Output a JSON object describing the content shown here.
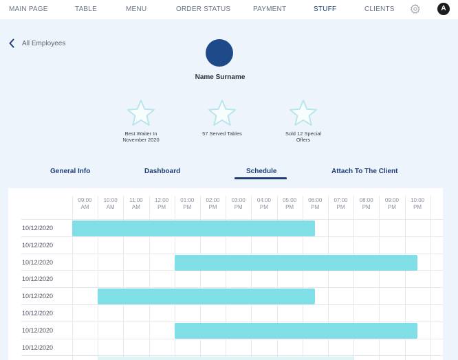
{
  "nav": {
    "items": [
      "MAIN PAGE",
      "TABLE",
      "MENU",
      "ORDER STATUS",
      "PAYMENT",
      "STUFF",
      "CLIENTS"
    ],
    "active": "STUFF",
    "settings_icon": "gear-icon",
    "user_initial": "A"
  },
  "back": {
    "label": "All Employees",
    "icon": "chevron-left-icon"
  },
  "profile": {
    "name": "Name Surname",
    "avatar_color": "#1f4a8a"
  },
  "achievements": [
    {
      "icon": "star-icon",
      "label_line1": "Best Waiter In",
      "label_line2": "November 2020"
    },
    {
      "icon": "star-icon",
      "label_line1": "57 Served Tables",
      "label_line2": ""
    },
    {
      "icon": "star-icon",
      "label_line1": "Sold 12 Special",
      "label_line2": "Offers"
    }
  ],
  "tabs": [
    "General Info",
    "Dashboard",
    "Schedule",
    "Attach To The Client"
  ],
  "active_tab": "Schedule",
  "schedule": {
    "times": [
      {
        "time": "09:00",
        "ampm": "AM"
      },
      {
        "time": "10:00",
        "ampm": "AM"
      },
      {
        "time": "11:00",
        "ampm": "AM"
      },
      {
        "time": "12:00",
        "ampm": "PM"
      },
      {
        "time": "01:00",
        "ampm": "PM"
      },
      {
        "time": "02:00",
        "ampm": "PM"
      },
      {
        "time": "03:00",
        "ampm": "PM"
      },
      {
        "time": "04:00",
        "ampm": "PM"
      },
      {
        "time": "05:00",
        "ampm": "PM"
      },
      {
        "time": "06:00",
        "ampm": "PM"
      },
      {
        "time": "07:00",
        "ampm": "PM"
      },
      {
        "time": "08:00",
        "ampm": "PM"
      },
      {
        "time": "09:00",
        "ampm": "PM"
      },
      {
        "time": "10:00",
        "ampm": "PM"
      }
    ],
    "rows": [
      {
        "date": "10/12/2020",
        "shift": [
          "09:00 AM",
          "06:30 PM"
        ]
      },
      {
        "date": "10/12/2020",
        "shift": null
      },
      {
        "date": "10/12/2020",
        "shift": [
          "01:00 PM",
          "10:30 PM"
        ]
      },
      {
        "date": "10/12/2020",
        "shift": null
      },
      {
        "date": "10/12/2020",
        "shift": [
          "10:00 AM",
          "06:30 PM"
        ]
      },
      {
        "date": "10/12/2020",
        "shift": null
      },
      {
        "date": "10/12/2020",
        "shift": [
          "01:00 PM",
          "10:30 PM"
        ]
      },
      {
        "date": "10/12/2020",
        "shift": null
      }
    ],
    "bar_color": "#80dfe6"
  }
}
